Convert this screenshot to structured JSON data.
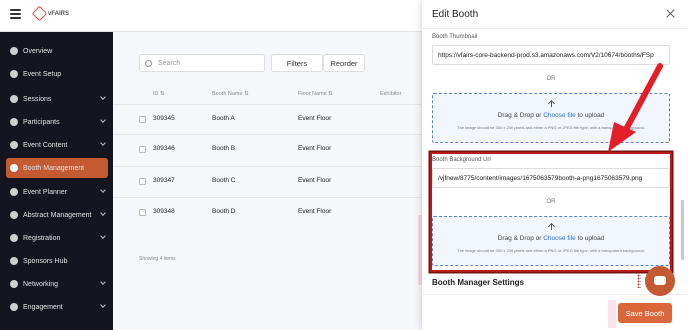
{
  "app": {
    "brand": "vFAIRS"
  },
  "sidebar": {
    "items": [
      {
        "label": "Overview",
        "icon": "overview-icon"
      },
      {
        "label": "Event Setup",
        "icon": "settings-icon"
      },
      {
        "label": "Sessions",
        "icon": "sessions-icon"
      },
      {
        "label": "Participants",
        "icon": "participants-icon"
      },
      {
        "label": "Event Content",
        "icon": "content-icon"
      },
      {
        "label": "Booth Management",
        "icon": "booth-icon"
      },
      {
        "label": "Event Planner",
        "icon": "planner-icon"
      },
      {
        "label": "Abstract Management",
        "icon": "abstract-icon"
      },
      {
        "label": "Registration",
        "icon": "registration-icon"
      },
      {
        "label": "Sponsors Hub",
        "icon": "sponsors-icon"
      },
      {
        "label": "Networking",
        "icon": "networking-icon"
      },
      {
        "label": "Engagement",
        "icon": "engagement-icon"
      }
    ],
    "active": "Booth Management"
  },
  "toolbar": {
    "search_placeholder": "Search",
    "filters_label": "Filters",
    "reorder_label": "Reorder"
  },
  "table": {
    "headers": [
      "ID ⇅",
      "Booth Name ⇅",
      "Floor Name ⇅",
      "Exhibitor"
    ],
    "rows": [
      {
        "id": "309345",
        "name": "Booth A",
        "floor": "Event Floor"
      },
      {
        "id": "309346",
        "name": "Booth B",
        "floor": "Event Floor"
      },
      {
        "id": "309347",
        "name": "Booth C",
        "floor": "Event Floor"
      },
      {
        "id": "309348",
        "name": "Booth D",
        "floor": "Event Floor"
      }
    ],
    "footer": "Showing 4 items"
  },
  "drawer": {
    "title": "Edit Booth",
    "thumbnail_label": "Booth Thumbnail",
    "thumbnail_value": "https://vfairs-core-backend-prod.s3.amazonaws.com/V2/10674/booths/FSp",
    "or_label": "OR",
    "dropzone_pre": "Drag & Drop or ",
    "dropzone_link": "Choose file",
    "dropzone_post": " to upload",
    "dropzone_hint": "The image should be 300 x 200 pixels and either a PNG or JPEG file type, with a transparent background.",
    "background_label": "Booth Background Url",
    "background_value": "/vjfnew/8775/content/images/1675063579booth-a-png1675063579.png",
    "manager_settings": "Booth Manager Settings",
    "save_label": "Save Booth"
  },
  "colors": {
    "accent": "#c45a32",
    "highlight": "#b41c1c",
    "link": "#2a6fd3"
  }
}
